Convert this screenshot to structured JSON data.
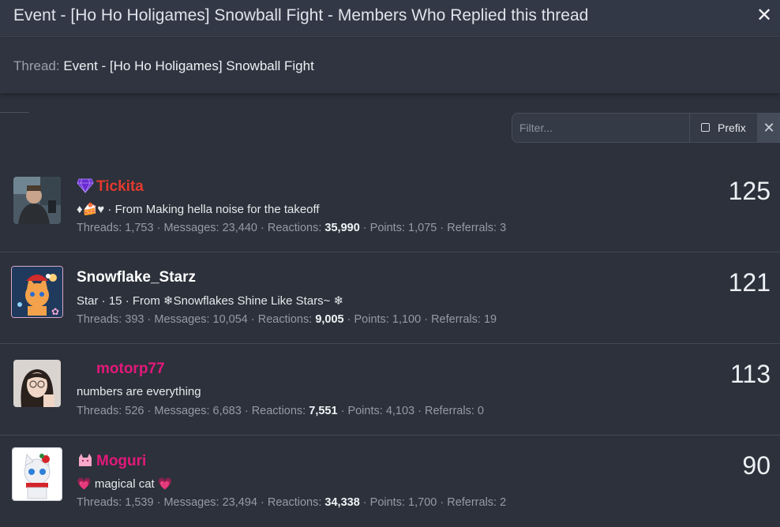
{
  "window": {
    "title": "Event - [Ho Ho Holigames] Snowball Fight - Members Who Replied this thread",
    "close_label": "✕"
  },
  "thread": {
    "label": "Thread:",
    "name": "Event - [Ho Ho Holigames] Snowball Fight"
  },
  "filter": {
    "placeholder": "Filter...",
    "prefix_label": "Prefix",
    "clear_label": "✕"
  },
  "stat_labels": {
    "threads": "Threads:",
    "messages": "Messages:",
    "reactions": "Reactions:",
    "points": "Points:",
    "referrals": "Referrals:"
  },
  "members": [
    {
      "name": "Tickita",
      "name_color": "#e03a2e",
      "badge_icon": "purple-heart-gem-icon",
      "tagline": "♦🍰♥ · From Making hella noise for the takeoff",
      "threads": "1,753",
      "messages": "23,440",
      "reactions": "35,990",
      "points": "1,075",
      "referrals": "3",
      "reply_count": "125"
    },
    {
      "name": "Snowflake_Starz",
      "name_color": "#ffffff",
      "badge_icon": "",
      "tagline": "Star · 15 · From ❄Snowflakes Shine Like Stars~ ❄",
      "threads": "393",
      "messages": "10,054",
      "reactions": "9,005",
      "points": "1,100",
      "referrals": "19",
      "reply_count": "121"
    },
    {
      "name": "motorp77",
      "name_color": "#e3197a",
      "badge_icon": "",
      "tagline": "numbers are everything",
      "threads": "526",
      "messages": "6,683",
      "reactions": "7,551",
      "points": "4,103",
      "referrals": "0",
      "reply_count": "113"
    },
    {
      "name": "Moguri",
      "name_color": "#e3197a",
      "badge_icon": "cat-icon",
      "tagline": "💗 magical cat 💗",
      "threads": "1,539",
      "messages": "23,494",
      "reactions": "34,338",
      "points": "1,700",
      "referrals": "2",
      "reply_count": "90"
    }
  ]
}
